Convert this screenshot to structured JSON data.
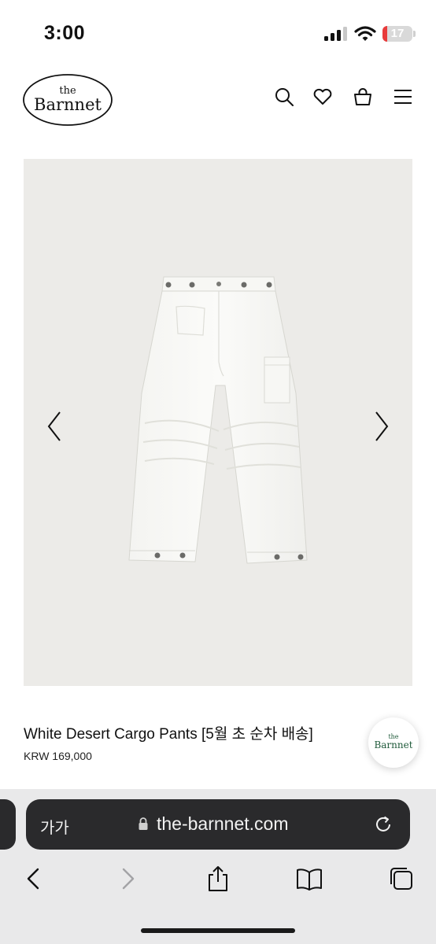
{
  "status_bar": {
    "time": "3:00",
    "battery_level": "17",
    "battery_color": "#e83b3b"
  },
  "header": {
    "logo": {
      "small": "the",
      "main": "Barnnet"
    },
    "icons": [
      "search-icon",
      "heart-icon",
      "bag-icon",
      "menu-icon"
    ]
  },
  "product": {
    "image_background": "#ecebe8",
    "title": "White Desert Cargo Pants [5월 초 순차 배송]",
    "price": "KRW 169,000"
  },
  "floating_badge": {
    "small": "the",
    "main": "Barnnet",
    "color": "#1f5a3a"
  },
  "browser": {
    "text_size_label": "가가",
    "url": "the-barnnet.com",
    "toolbar_icons": [
      "back-icon",
      "forward-icon",
      "share-icon",
      "bookmarks-icon",
      "tabs-icon"
    ]
  }
}
